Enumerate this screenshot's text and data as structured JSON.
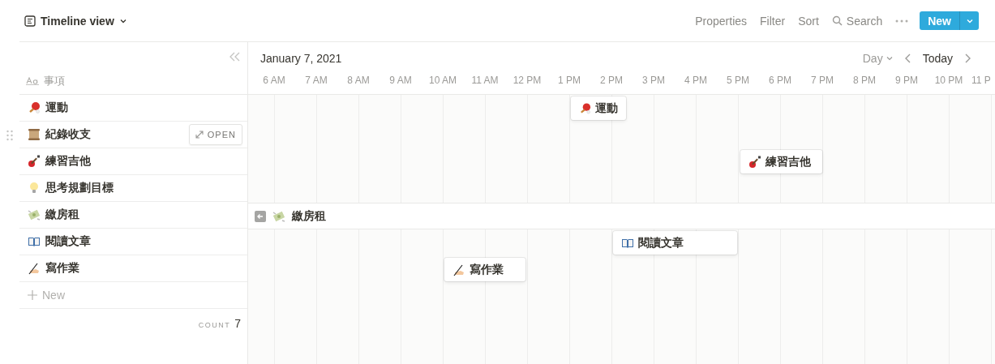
{
  "view": {
    "title": "Timeline view"
  },
  "toolbar": {
    "items": [
      "Properties",
      "Filter",
      "Sort"
    ],
    "search": "Search",
    "new_button": "New"
  },
  "list": {
    "column": "事項",
    "open_label": "OPEN",
    "new_row": "New",
    "count_label": "COUNT",
    "count": "7",
    "rows": [
      {
        "title": "運動",
        "hovered": false
      },
      {
        "title": "紀錄收支",
        "hovered": true
      },
      {
        "title": "練習吉他",
        "hovered": false
      },
      {
        "title": "思考規劃目標",
        "hovered": false
      },
      {
        "title": "繳房租",
        "hovered": false
      },
      {
        "title": "閱讀文章",
        "hovered": false
      },
      {
        "title": "寫作業",
        "hovered": false
      }
    ]
  },
  "timeline": {
    "date": "January 7, 2021",
    "zoom": "Day",
    "today": "Today",
    "hours": [
      "6 AM",
      "7 AM",
      "8 AM",
      "9 AM",
      "10 AM",
      "11 AM",
      "12 PM",
      "1 PM",
      "2 PM",
      "3 PM",
      "4 PM",
      "5 PM",
      "6 PM",
      "7 PM",
      "8 PM",
      "9 PM",
      "10 PM",
      "11 P"
    ],
    "items": [
      {
        "kind": "card",
        "title": "運動"
      },
      {
        "kind": "none"
      },
      {
        "kind": "card",
        "title": "練習吉他"
      },
      {
        "kind": "none"
      },
      {
        "kind": "offscreen",
        "title": "繳房租"
      },
      {
        "kind": "card",
        "title": "閱讀文章"
      },
      {
        "kind": "card",
        "title": "寫作業"
      }
    ]
  }
}
